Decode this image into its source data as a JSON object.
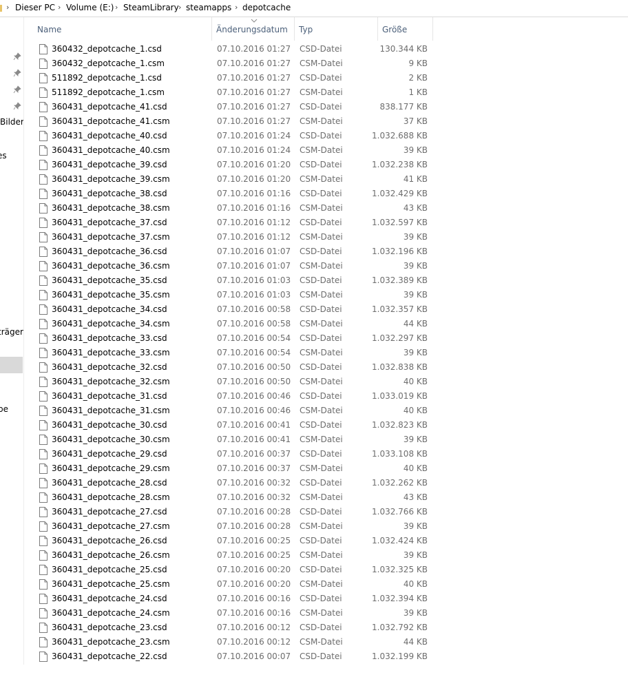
{
  "breadcrumb": {
    "items": [
      "Dieser PC",
      "Volume (E:)",
      "SteamLibrary",
      "steamapps",
      "depotcache"
    ]
  },
  "nav": {
    "labels": [
      "Bilder",
      "es",
      "träger",
      "pe"
    ]
  },
  "columns": {
    "name": "Name",
    "date": "Änderungsdatum",
    "type": "Typ",
    "size": "Größe"
  },
  "files": [
    {
      "name": "360432_depotcache_1.csd",
      "date": "07.10.2016 01:27",
      "type": "CSD-Datei",
      "size": "130.344 KB"
    },
    {
      "name": "360432_depotcache_1.csm",
      "date": "07.10.2016 01:27",
      "type": "CSM-Datei",
      "size": "9 KB"
    },
    {
      "name": "511892_depotcache_1.csd",
      "date": "07.10.2016 01:27",
      "type": "CSD-Datei",
      "size": "2 KB"
    },
    {
      "name": "511892_depotcache_1.csm",
      "date": "07.10.2016 01:27",
      "type": "CSM-Datei",
      "size": "1 KB"
    },
    {
      "name": "360431_depotcache_41.csd",
      "date": "07.10.2016 01:27",
      "type": "CSD-Datei",
      "size": "838.177 KB"
    },
    {
      "name": "360431_depotcache_41.csm",
      "date": "07.10.2016 01:27",
      "type": "CSM-Datei",
      "size": "37 KB"
    },
    {
      "name": "360431_depotcache_40.csd",
      "date": "07.10.2016 01:24",
      "type": "CSD-Datei",
      "size": "1.032.688 KB"
    },
    {
      "name": "360431_depotcache_40.csm",
      "date": "07.10.2016 01:24",
      "type": "CSM-Datei",
      "size": "39 KB"
    },
    {
      "name": "360431_depotcache_39.csd",
      "date": "07.10.2016 01:20",
      "type": "CSD-Datei",
      "size": "1.032.238 KB"
    },
    {
      "name": "360431_depotcache_39.csm",
      "date": "07.10.2016 01:20",
      "type": "CSM-Datei",
      "size": "41 KB"
    },
    {
      "name": "360431_depotcache_38.csd",
      "date": "07.10.2016 01:16",
      "type": "CSD-Datei",
      "size": "1.032.429 KB"
    },
    {
      "name": "360431_depotcache_38.csm",
      "date": "07.10.2016 01:16",
      "type": "CSM-Datei",
      "size": "43 KB"
    },
    {
      "name": "360431_depotcache_37.csd",
      "date": "07.10.2016 01:12",
      "type": "CSD-Datei",
      "size": "1.032.597 KB"
    },
    {
      "name": "360431_depotcache_37.csm",
      "date": "07.10.2016 01:12",
      "type": "CSM-Datei",
      "size": "39 KB"
    },
    {
      "name": "360431_depotcache_36.csd",
      "date": "07.10.2016 01:07",
      "type": "CSD-Datei",
      "size": "1.032.196 KB"
    },
    {
      "name": "360431_depotcache_36.csm",
      "date": "07.10.2016 01:07",
      "type": "CSM-Datei",
      "size": "39 KB"
    },
    {
      "name": "360431_depotcache_35.csd",
      "date": "07.10.2016 01:03",
      "type": "CSD-Datei",
      "size": "1.032.389 KB"
    },
    {
      "name": "360431_depotcache_35.csm",
      "date": "07.10.2016 01:03",
      "type": "CSM-Datei",
      "size": "39 KB"
    },
    {
      "name": "360431_depotcache_34.csd",
      "date": "07.10.2016 00:58",
      "type": "CSD-Datei",
      "size": "1.032.357 KB"
    },
    {
      "name": "360431_depotcache_34.csm",
      "date": "07.10.2016 00:58",
      "type": "CSM-Datei",
      "size": "44 KB"
    },
    {
      "name": "360431_depotcache_33.csd",
      "date": "07.10.2016 00:54",
      "type": "CSD-Datei",
      "size": "1.032.297 KB"
    },
    {
      "name": "360431_depotcache_33.csm",
      "date": "07.10.2016 00:54",
      "type": "CSM-Datei",
      "size": "39 KB"
    },
    {
      "name": "360431_depotcache_32.csd",
      "date": "07.10.2016 00:50",
      "type": "CSD-Datei",
      "size": "1.032.838 KB"
    },
    {
      "name": "360431_depotcache_32.csm",
      "date": "07.10.2016 00:50",
      "type": "CSM-Datei",
      "size": "40 KB"
    },
    {
      "name": "360431_depotcache_31.csd",
      "date": "07.10.2016 00:46",
      "type": "CSD-Datei",
      "size": "1.033.019 KB"
    },
    {
      "name": "360431_depotcache_31.csm",
      "date": "07.10.2016 00:46",
      "type": "CSM-Datei",
      "size": "40 KB"
    },
    {
      "name": "360431_depotcache_30.csd",
      "date": "07.10.2016 00:41",
      "type": "CSD-Datei",
      "size": "1.032.823 KB"
    },
    {
      "name": "360431_depotcache_30.csm",
      "date": "07.10.2016 00:41",
      "type": "CSM-Datei",
      "size": "39 KB"
    },
    {
      "name": "360431_depotcache_29.csd",
      "date": "07.10.2016 00:37",
      "type": "CSD-Datei",
      "size": "1.033.108 KB"
    },
    {
      "name": "360431_depotcache_29.csm",
      "date": "07.10.2016 00:37",
      "type": "CSM-Datei",
      "size": "40 KB"
    },
    {
      "name": "360431_depotcache_28.csd",
      "date": "07.10.2016 00:32",
      "type": "CSD-Datei",
      "size": "1.032.262 KB"
    },
    {
      "name": "360431_depotcache_28.csm",
      "date": "07.10.2016 00:32",
      "type": "CSM-Datei",
      "size": "43 KB"
    },
    {
      "name": "360431_depotcache_27.csd",
      "date": "07.10.2016 00:28",
      "type": "CSD-Datei",
      "size": "1.032.766 KB"
    },
    {
      "name": "360431_depotcache_27.csm",
      "date": "07.10.2016 00:28",
      "type": "CSM-Datei",
      "size": "39 KB"
    },
    {
      "name": "360431_depotcache_26.csd",
      "date": "07.10.2016 00:25",
      "type": "CSD-Datei",
      "size": "1.032.424 KB"
    },
    {
      "name": "360431_depotcache_26.csm",
      "date": "07.10.2016 00:25",
      "type": "CSM-Datei",
      "size": "39 KB"
    },
    {
      "name": "360431_depotcache_25.csd",
      "date": "07.10.2016 00:20",
      "type": "CSD-Datei",
      "size": "1.032.325 KB"
    },
    {
      "name": "360431_depotcache_25.csm",
      "date": "07.10.2016 00:20",
      "type": "CSM-Datei",
      "size": "40 KB"
    },
    {
      "name": "360431_depotcache_24.csd",
      "date": "07.10.2016 00:16",
      "type": "CSD-Datei",
      "size": "1.032.394 KB"
    },
    {
      "name": "360431_depotcache_24.csm",
      "date": "07.10.2016 00:16",
      "type": "CSM-Datei",
      "size": "39 KB"
    },
    {
      "name": "360431_depotcache_23.csd",
      "date": "07.10.2016 00:12",
      "type": "CSD-Datei",
      "size": "1.032.792 KB"
    },
    {
      "name": "360431_depotcache_23.csm",
      "date": "07.10.2016 00:12",
      "type": "CSM-Datei",
      "size": "44 KB"
    },
    {
      "name": "360431_depotcache_22.csd",
      "date": "07.10.2016 00:07",
      "type": "CSD-Datei",
      "size": "1.032.199 KB"
    }
  ]
}
